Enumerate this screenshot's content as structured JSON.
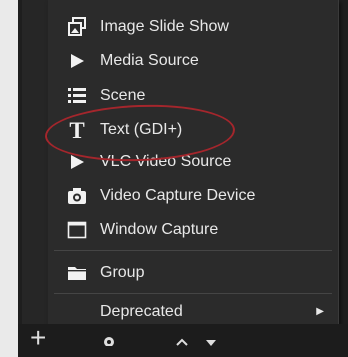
{
  "menu": {
    "items": [
      {
        "label": "Image Slide Show",
        "icon": "slideshow-icon"
      },
      {
        "label": "Media Source",
        "icon": "play-icon"
      },
      {
        "label": "Scene",
        "icon": "list-icon"
      },
      {
        "label": "Text (GDI+)",
        "icon": "text-icon"
      },
      {
        "label": "VLC Video Source",
        "icon": "play-icon"
      },
      {
        "label": "Video Capture Device",
        "icon": "camera-icon"
      },
      {
        "label": "Window Capture",
        "icon": "window-icon"
      },
      {
        "label": "Group",
        "icon": "folder-icon"
      },
      {
        "label": "Deprecated",
        "icon": "none",
        "has_submenu": true
      }
    ]
  },
  "toolbar": {
    "add_label": "+"
  },
  "colors": {
    "menu_bg": "#2b2b2b",
    "menu_text": "#e8e8e8",
    "highlight_ellipse": "#a4262c"
  }
}
